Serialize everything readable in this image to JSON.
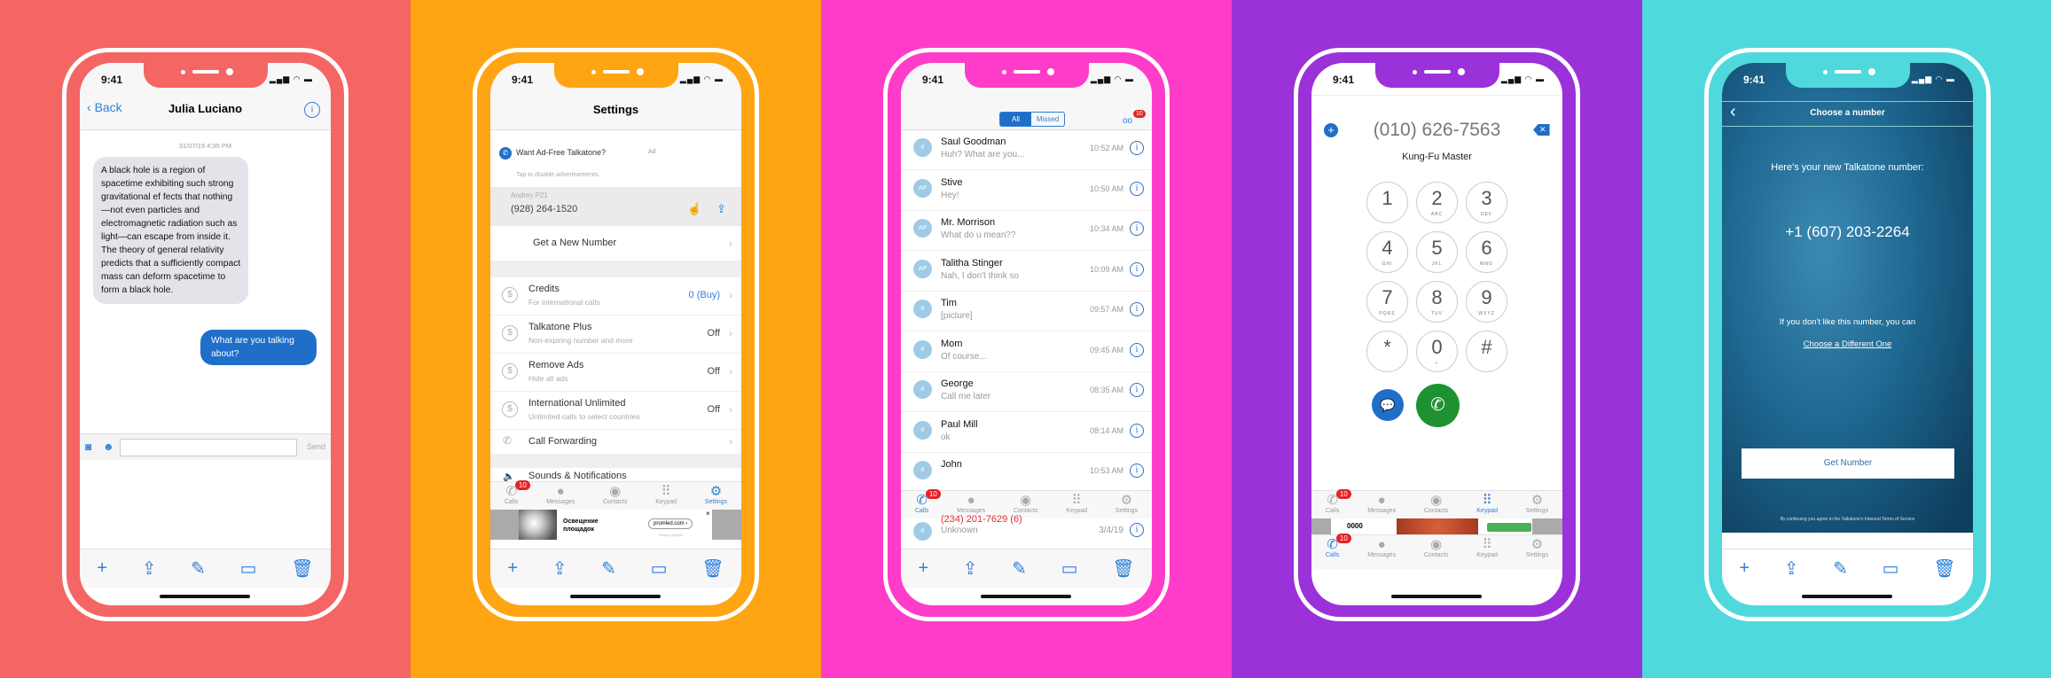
{
  "colors": {
    "panel1": "#F46664",
    "panel2": "#FFA412",
    "panel3": "#FF3CC9",
    "panel4": "#9B31D8",
    "panel5": "#4FD9DD",
    "accent": "#2F7FD8",
    "call_green": "#1E9230",
    "badge_red": "#E52121"
  },
  "status": {
    "time": "9:41",
    "icons": "signal-wifi-battery"
  },
  "toolbar_icons": [
    "plus-icon",
    "share-icon",
    "compose-icon",
    "folder-icon",
    "trash-icon"
  ],
  "tabs": [
    "Calls",
    "Messages",
    "Contacts",
    "Keypad",
    "Settings"
  ],
  "tab_badge": "10",
  "chat": {
    "back": "Back",
    "title": "Julia Luciano",
    "timestamp": "31/07/19 4:35 PM",
    "incoming": "A black hole is a region of spacetime exhibiting such strong gravitational ef fects that nothing—not even particles and electromagnetic radiation such as light—can escape from inside it.  The theory of general relativity predicts that a sufficiently compact mass can deform spacetime to form a black hole.",
    "outgoing": "What are you talking about?",
    "input_value": "",
    "send": "Send"
  },
  "settings": {
    "title": "Settings",
    "ad_title": "Want Ad-Free Talkatone?",
    "ad_tag": "Ad",
    "ad_sub": "Tap to disable advertisements.",
    "account_name": "Andrey P21",
    "account_number": "(928) 264-1520",
    "new_number": "Get a New Number",
    "rows": [
      {
        "title": "Credits",
        "sub": "For international calls",
        "value": "0 (Buy)"
      },
      {
        "title": "Talkatone Plus",
        "sub": "Non-expiring number and more",
        "value": "Off"
      },
      {
        "title": "Remove Ads",
        "sub": "Hide all ads",
        "value": "Off"
      },
      {
        "title": "International Unlimited",
        "sub": "Unlimited calls to select countries",
        "value": "Off"
      }
    ],
    "call_forwarding": "Call Forwarding",
    "sounds": "Sounds & Notifications",
    "banner": {
      "title": "Освещение площадок",
      "link": "promled.com ›",
      "source": "Яндекс.Директ",
      "close": "×"
    }
  },
  "calls": {
    "seg_all": "All",
    "seg_missed": "Missed",
    "voicemail_badge": "10",
    "rows": [
      {
        "name": "Saul Goodman",
        "preview": "Huh? What are you...",
        "time": "10:52 AM",
        "initials": "#"
      },
      {
        "name": "Stive",
        "preview": "Hey!",
        "time": "10:50 AM",
        "initials": "AP"
      },
      {
        "name": "Mr. Morrison",
        "preview": "What do u mean??",
        "time": "10:34 AM",
        "initials": "AP"
      },
      {
        "name": "Talitha Stinger",
        "preview": "Nah, I don't think so",
        "time": "10:09 AM",
        "initials": "AP"
      },
      {
        "name": "Tim",
        "preview": "[picture]",
        "time": "09:57 AM",
        "initials": "#"
      },
      {
        "name": "Mom",
        "preview": "Of course...",
        "time": "09:45 AM",
        "initials": "#"
      },
      {
        "name": "George",
        "preview": "Call me later",
        "time": "08:35 AM",
        "initials": "#"
      },
      {
        "name": "Paul Mill",
        "preview": "ok",
        "time": "08:14 AM",
        "initials": "#"
      },
      {
        "name": "John",
        "preview": "",
        "time": "10:53 AM",
        "initials": "#"
      }
    ],
    "missed": {
      "name": "(234) 201-7629 (6)",
      "preview": "Unknown",
      "time": "3/4/19"
    }
  },
  "keypad": {
    "number": "(010) 626-7563",
    "contact": "Kung-Fu Master",
    "keys": [
      {
        "d": "1",
        "l": ""
      },
      {
        "d": "2",
        "l": "ABC"
      },
      {
        "d": "3",
        "l": "DEF"
      },
      {
        "d": "4",
        "l": "GHI"
      },
      {
        "d": "5",
        "l": "JKL"
      },
      {
        "d": "6",
        "l": "MNO"
      },
      {
        "d": "7",
        "l": "PQRS"
      },
      {
        "d": "8",
        "l": "TUV"
      },
      {
        "d": "9",
        "l": "WXYZ"
      },
      {
        "d": "*",
        "l": ""
      },
      {
        "d": "0",
        "l": "+"
      },
      {
        "d": "#",
        "l": ""
      }
    ],
    "ad_text": "0000"
  },
  "choose": {
    "title": "Choose a number",
    "intro": "Here's your new Talkatone number:",
    "number": "+1 (607) 203-2264",
    "dislike": "If you don't like this number, you can",
    "different": "Choose a Different One",
    "button": "Get Number",
    "terms": "By continuing you agree to the Talkatone's Inbound Terms of Service"
  }
}
